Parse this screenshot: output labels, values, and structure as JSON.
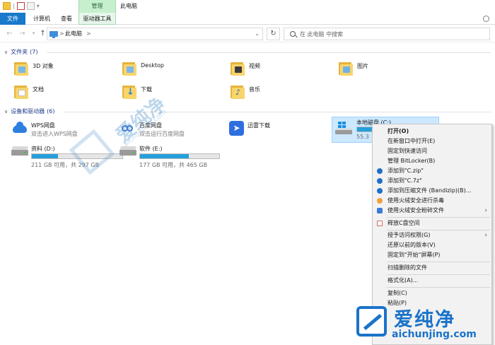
{
  "window": {
    "title": "此电脑",
    "context_tab_group": "管理"
  },
  "ribbon": {
    "tabs": [
      "文件",
      "计算机",
      "查看",
      "驱动器工具"
    ]
  },
  "address_bar": {
    "crumb": "此电脑",
    "separator": ">"
  },
  "search": {
    "placeholder": "在 此电脑 中搜索"
  },
  "groups": {
    "folders": {
      "title": "文件夹",
      "count": "(7)"
    },
    "devices": {
      "title": "设备和驱动器",
      "count": "(6)"
    }
  },
  "folders": [
    {
      "name": "3D 对象",
      "icon": "3d-objects-folder-icon"
    },
    {
      "name": "Desktop",
      "icon": "desktop-folder-icon"
    },
    {
      "name": "视频",
      "icon": "videos-folder-icon"
    },
    {
      "name": "图片",
      "icon": "pictures-folder-icon"
    },
    {
      "name": "文档",
      "icon": "documents-folder-icon"
    },
    {
      "name": "下载",
      "icon": "downloads-folder-icon"
    },
    {
      "name": "音乐",
      "icon": "music-folder-icon"
    }
  ],
  "devices": [
    {
      "name": "WPS网盘",
      "subtitle": "双击进入WPS网盘",
      "icon": "wps-cloud-icon"
    },
    {
      "name": "百度网盘",
      "subtitle": "双击运行百度网盘",
      "icon": "baidu-netdisk-icon"
    },
    {
      "name": "迅雷下载",
      "icon": "xunlei-icon"
    },
    {
      "name": "本地磁盘 (C:)",
      "size_text": "55.3",
      "icon": "windows-drive-icon",
      "usage_fraction": 0.88
    },
    {
      "name": "资料 (D:)",
      "size_text": "211 GB 可用，共 297 GB",
      "icon": "drive-icon",
      "usage_fraction": 0.29
    },
    {
      "name": "软件 (E:)",
      "size_text": "177 GB 可用，共 465 GB",
      "icon": "drive-icon",
      "usage_fraction": 0.62
    }
  ],
  "context_menu": {
    "items": [
      {
        "label": "打开(O)",
        "bold": true
      },
      {
        "label": "在新窗口中打开(E)"
      },
      {
        "label": "固定到快速访问"
      },
      {
        "label": "管理 BitLocker(B)"
      },
      {
        "label": "添加到\"C.zip\"",
        "icon": "bandizip-icon"
      },
      {
        "label": "添加到\"C.7z\"",
        "icon": "bandizip-icon"
      },
      {
        "label": "添加到压缩文件 (Bandizip)(B)...",
        "icon": "bandizip-icon"
      },
      {
        "label": "使用火绒安全进行杀毒",
        "icon": "huorong-icon"
      },
      {
        "label": "使用火绒安全粉碎文件",
        "icon": "shield-icon",
        "submenu": true
      },
      {
        "label": "释放C盘空间",
        "icon": "free-space-icon"
      },
      {
        "label": "授予访问权限(G)",
        "submenu": true
      },
      {
        "label": "还原以前的版本(V)"
      },
      {
        "label": "固定到\"开始\"屏幕(P)"
      },
      {
        "label": "扫描删除的文件"
      },
      {
        "label": "格式化(A)..."
      },
      {
        "label": "复制(C)"
      },
      {
        "label": "粘贴(P)"
      }
    ]
  },
  "watermark": {
    "cn": "爱纯净",
    "url": "aichunjing.com"
  },
  "colors": {
    "accent": "#1979ca",
    "drive_bar": "#26a0da",
    "selection": "#cce8ff",
    "brand": "#1a73c9"
  }
}
